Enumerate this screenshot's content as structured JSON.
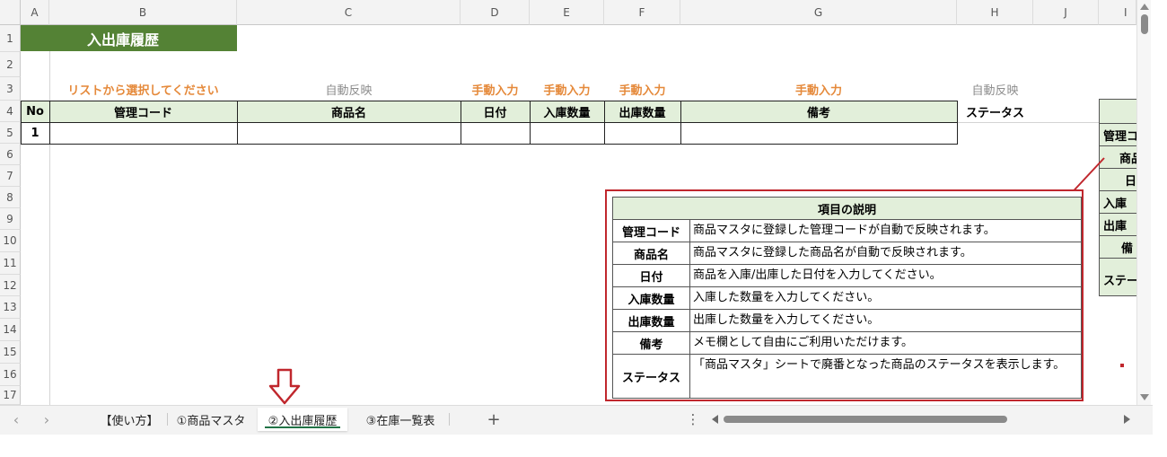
{
  "columns": [
    "A",
    "B",
    "C",
    "D",
    "E",
    "F",
    "G",
    "H",
    "J",
    "I"
  ],
  "rows": [
    "1",
    "2",
    "3",
    "4",
    "5",
    "6",
    "7",
    "8",
    "9",
    "10",
    "11",
    "12",
    "13",
    "14",
    "15",
    "16",
    "17"
  ],
  "sheet": {
    "title": "入出庫履歴",
    "row3": {
      "b": "リストから選択してください",
      "c": "自動反映",
      "d": "手動入力",
      "e": "手動入力",
      "f": "手動入力",
      "g": "手動入力",
      "h": "自動反映"
    },
    "headers": {
      "no": "No",
      "code": "管理コード",
      "name": "商品名",
      "date": "日付",
      "in_qty": "入庫数量",
      "out_qty": "出庫数量",
      "note": "備考",
      "status": "ステータス"
    },
    "row5_no": "1"
  },
  "side_panel": {
    "items": [
      "管理コ",
      "商品",
      "日",
      "入庫",
      "出庫",
      "備",
      "ステー"
    ]
  },
  "explanation": {
    "title": "項目の説明",
    "rows": [
      {
        "key": "管理コード",
        "value": "商品マスタに登録した管理コードが自動で反映されます。"
      },
      {
        "key": "商品名",
        "value": "商品マスタに登録した商品名が自動で反映されます。"
      },
      {
        "key": "日付",
        "value": "商品を入庫/出庫した日付を入力してください。"
      },
      {
        "key": "入庫数量",
        "value": "入庫した数量を入力してください。"
      },
      {
        "key": "出庫数量",
        "value": "出庫した数量を入力してください。"
      },
      {
        "key": "備考",
        "value": "メモ欄として自由にご利用いただけます。"
      },
      {
        "key": "ステータス",
        "value": "「商品マスタ」シートで廃番となった商品のステータスを表示します。"
      }
    ]
  },
  "tabs": {
    "t1": "【使い方】",
    "t2": "①商品マスタ",
    "t3": "②入出庫履歴",
    "t4": "③在庫一覧表",
    "add": "+",
    "more": "⋮"
  },
  "colors": {
    "title_bg": "#548235",
    "header_bg": "#e2efda",
    "accent_orange": "#e5893a",
    "callout_red": "#c0272d",
    "active_tab": "#217346"
  }
}
